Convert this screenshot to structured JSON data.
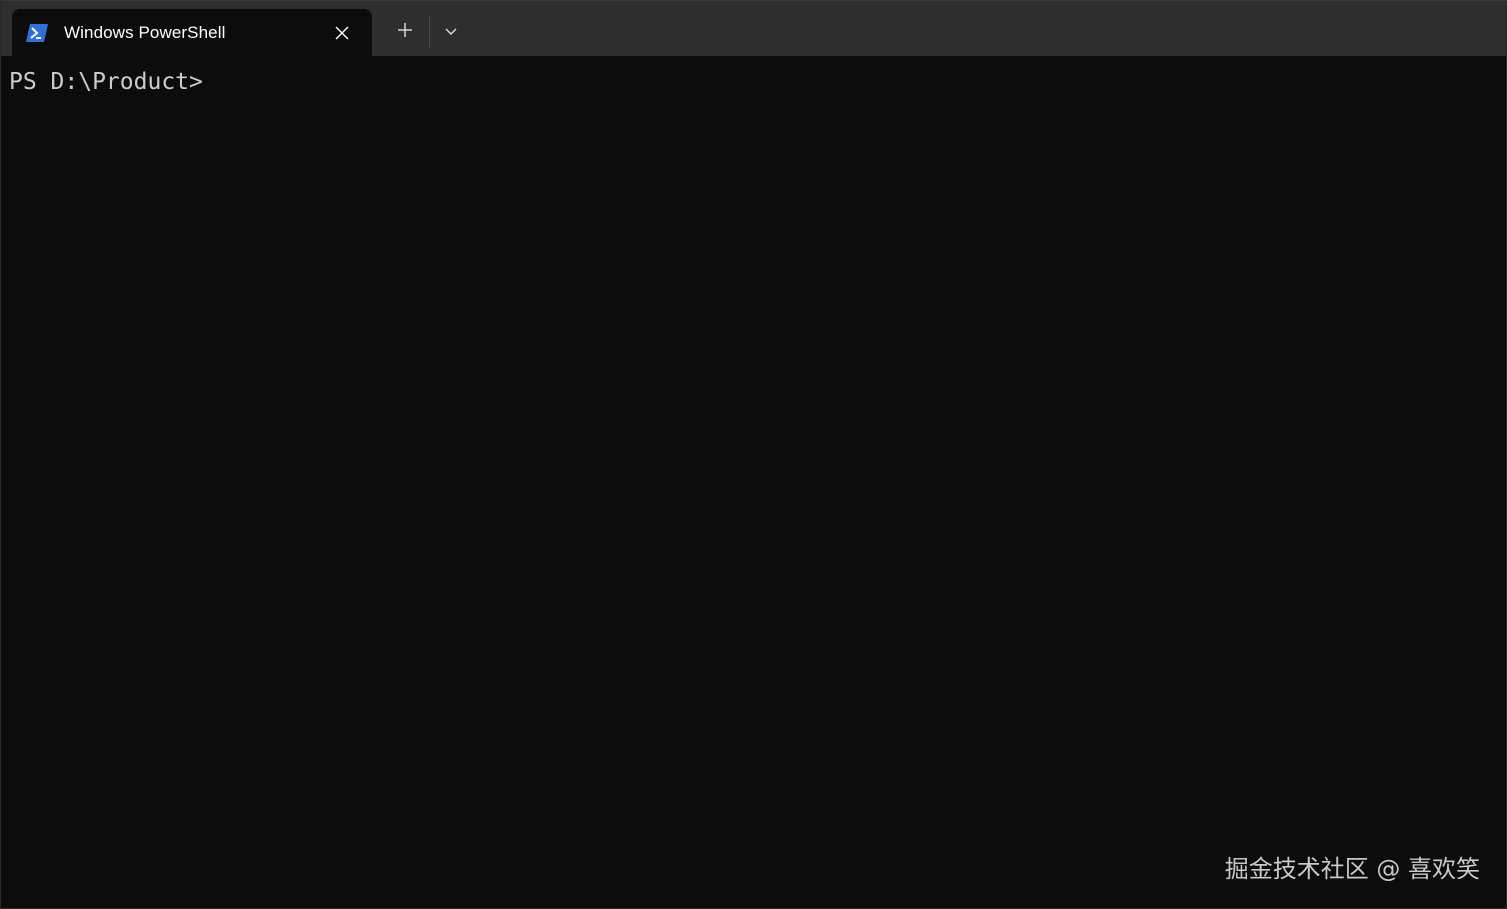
{
  "tab": {
    "title": "Windows PowerShell",
    "icon": "powershell-icon",
    "close_icon": "close-icon"
  },
  "toolbar": {
    "new_tab_icon": "plus-icon",
    "dropdown_icon": "chevron-down-icon"
  },
  "terminal": {
    "prompt": "PS D:\\Product>"
  },
  "watermark": {
    "text": "掘金技术社区 @ 喜欢笑"
  },
  "colors": {
    "tabbar_bg": "#2e2e2e",
    "terminal_bg": "#0c0c0c",
    "text": "#cccccc",
    "powershell_blue": "#2f6fd6"
  }
}
